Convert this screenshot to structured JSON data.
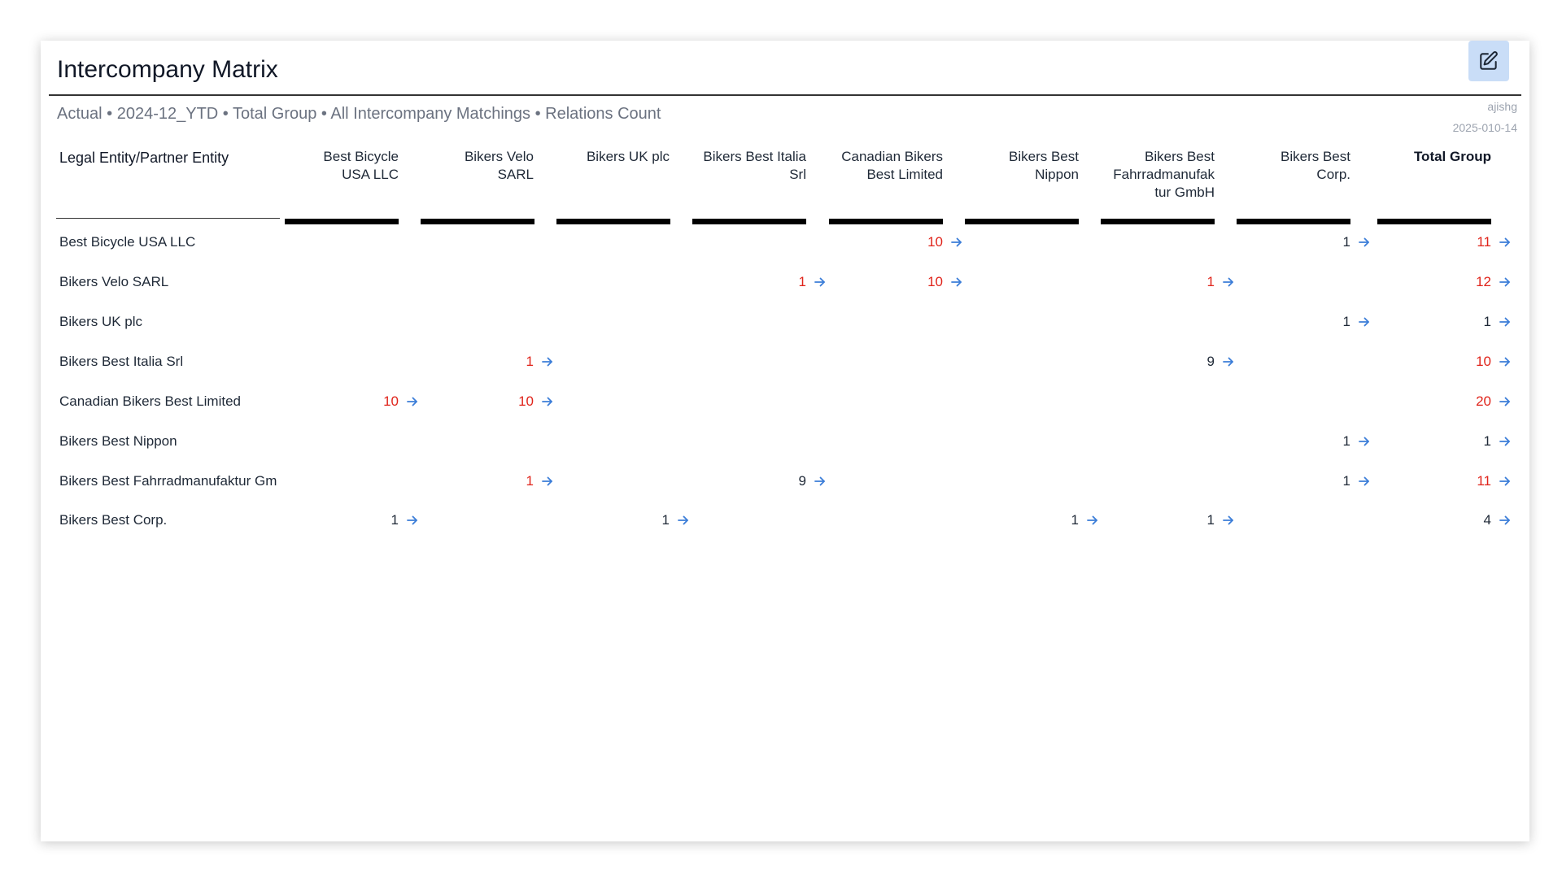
{
  "widget": {
    "title": "Intercompany Matrix",
    "subtitle": "Actual • 2024-12_YTD • Total Group • All Intercompany Matchings • Relations Count",
    "meta_user": "ajishg",
    "meta_date": "2025-010-14",
    "edit_icon": "edit-pencil-icon"
  },
  "matrix": {
    "corner_label": "Legal Entity/Partner Entity",
    "columns": [
      {
        "lines": [
          "Best Bicycle",
          "USA LLC"
        ]
      },
      {
        "lines": [
          "Bikers Velo",
          "SARL"
        ]
      },
      {
        "lines": [
          "Bikers UK plc"
        ]
      },
      {
        "lines": [
          "Bikers Best Italia",
          "Srl"
        ]
      },
      {
        "lines": [
          "Canadian Bikers",
          "Best Limited"
        ]
      },
      {
        "lines": [
          "Bikers Best",
          "Nippon"
        ]
      },
      {
        "lines": [
          "Bikers Best",
          "Fahrradmanufak",
          "tur GmbH"
        ]
      },
      {
        "lines": [
          "Bikers Best",
          "Corp."
        ]
      },
      {
        "lines": [
          "Total Group"
        ],
        "total": true
      }
    ],
    "rows": [
      {
        "label": "Best Bicycle USA LLC",
        "cells": [
          "",
          "",
          "",
          "",
          "10",
          "",
          "",
          "1",
          "11"
        ]
      },
      {
        "label": "Bikers Velo SARL",
        "cells": [
          "",
          "",
          "",
          "1",
          "10",
          "",
          "1",
          "",
          "12"
        ]
      },
      {
        "label": "Bikers UK plc",
        "cells": [
          "",
          "",
          "",
          "",
          "",
          "",
          "",
          "1",
          "1"
        ]
      },
      {
        "label": "Bikers Best Italia Srl",
        "cells": [
          "",
          "1",
          "",
          "",
          "",
          "",
          "9",
          "",
          "10"
        ]
      },
      {
        "label": "Canadian Bikers Best Limited",
        "cells": [
          "10",
          "10",
          "",
          "",
          "",
          "",
          "",
          "",
          "20"
        ]
      },
      {
        "label": "Bikers Best Nippon",
        "cells": [
          "",
          "",
          "",
          "",
          "",
          "",
          "",
          "1",
          "1"
        ]
      },
      {
        "label": "Bikers Best Fahrradmanufaktur GmbH",
        "cells": [
          "",
          "1",
          "",
          "9",
          "",
          "",
          "",
          "1",
          "11"
        ]
      },
      {
        "label": "Bikers Best Corp.",
        "cells": [
          "1",
          "",
          "1",
          "",
          "",
          "1",
          "1",
          "",
          "4"
        ]
      }
    ],
    "highlight_cells": [
      [
        0,
        4
      ],
      [
        0,
        8
      ],
      [
        1,
        3
      ],
      [
        1,
        4
      ],
      [
        1,
        6
      ],
      [
        1,
        8
      ],
      [
        3,
        1
      ],
      [
        3,
        8
      ],
      [
        4,
        0
      ],
      [
        4,
        1
      ],
      [
        4,
        8
      ],
      [
        6,
        1
      ],
      [
        6,
        8
      ]
    ],
    "arrow_icon": "arrow-right-icon"
  },
  "colors": {
    "highlight": "#e0241b",
    "normal": "#1f2937",
    "arrow": "#3b7dd8",
    "edit_bg": "#c9ddf7"
  }
}
